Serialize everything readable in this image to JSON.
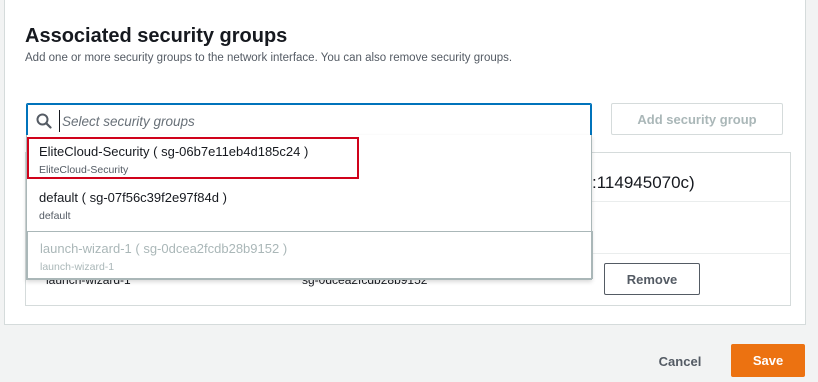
{
  "section": {
    "title": "Associated security groups",
    "description": "Add one or more security groups to the network interface. You can also remove security groups."
  },
  "search": {
    "placeholder": "Select security groups",
    "value": "",
    "icon": "search-icon"
  },
  "add_button_label": "Add security group",
  "dropdown_options": [
    {
      "label": "EliteCloud-Security ( sg-06b7e11eb4d185c24 )",
      "sublabel": "EliteCloud-Security",
      "state": "highlighted"
    },
    {
      "label": "default ( sg-07f56c39f2e97f84d )",
      "sublabel": "default",
      "state": "normal"
    },
    {
      "label": "launch-wizard-1 ( sg-0dcea2fcdb28b9152 )",
      "sublabel": "launch-wizard-1",
      "state": "disabled"
    }
  ],
  "table": {
    "header_fragment": ":114945070c)",
    "rows": [
      {
        "name": "launch-wizard-1",
        "id": "sg-0dcea2fcdb28b9152",
        "action": "Remove"
      }
    ]
  },
  "footer": {
    "cancel_label": "Cancel",
    "save_label": "Save"
  },
  "colors": {
    "accent": "#0073bb",
    "primary_button": "#ec7211",
    "highlight_border": "#d0021b"
  }
}
